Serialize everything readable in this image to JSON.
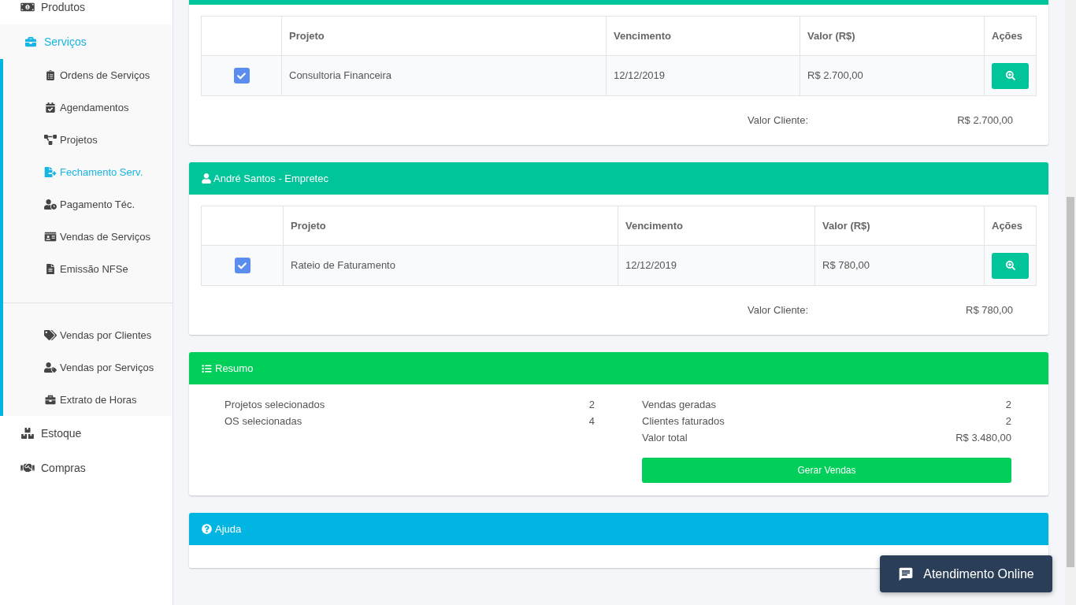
{
  "sidebar": {
    "items": [
      {
        "label": "Produtos",
        "selected": false
      },
      {
        "label": "Serviços",
        "selected": true,
        "expanded": true,
        "groups": [
          {
            "items": [
              {
                "label": "Ordens de Serviços",
                "selected": false
              },
              {
                "label": "Agendamentos",
                "selected": false
              },
              {
                "label": "Projetos",
                "selected": false
              },
              {
                "label": "Fechamento Serv.",
                "selected": true
              },
              {
                "label": "Pagamento Téc.",
                "selected": false
              },
              {
                "label": "Vendas de Serviços",
                "selected": false
              },
              {
                "label": "Emissão NFSe",
                "selected": false
              }
            ]
          },
          {
            "items": [
              {
                "label": "Vendas por Clientes",
                "selected": false
              },
              {
                "label": "Vendas por Serviços",
                "selected": false
              },
              {
                "label": "Extrato de Horas",
                "selected": false
              }
            ]
          }
        ]
      },
      {
        "label": "Estoque",
        "selected": false
      },
      {
        "label": "Compras",
        "selected": false
      }
    ]
  },
  "clients": [
    {
      "columns": [
        "Projeto",
        "Vencimento",
        "Valor (R$)",
        "Ações"
      ],
      "rows": [
        {
          "checked": true,
          "project": "Consultoria Financeira",
          "due": "12/12/2019",
          "value": "R$ 2.700,00"
        }
      ],
      "total_label": "Valor Cliente:",
      "total": "R$ 2.700,00"
    },
    {
      "title": "André Santos - Empretec",
      "columns": [
        "Projeto",
        "Vencimento",
        "Valor (R$)",
        "Ações"
      ],
      "rows": [
        {
          "checked": true,
          "project": "Rateio de Faturamento",
          "due": "12/12/2019",
          "value": "R$ 780,00"
        }
      ],
      "total_label": "Valor Cliente:",
      "total": "R$ 780,00"
    }
  ],
  "summary": {
    "title": "Resumo",
    "left": [
      {
        "label": "Projetos selecionados",
        "value": "2"
      },
      {
        "label": "OS selecionadas",
        "value": "4"
      }
    ],
    "right": [
      {
        "label": "Vendas geradas",
        "value": "2"
      },
      {
        "label": "Clientes faturados",
        "value": "2"
      },
      {
        "label": "Valor total",
        "value": "R$ 3.480,00"
      }
    ],
    "button": "Gerar Vendas"
  },
  "help": {
    "title": "Ajuda"
  },
  "chat": {
    "label": "Atendimento Online"
  }
}
